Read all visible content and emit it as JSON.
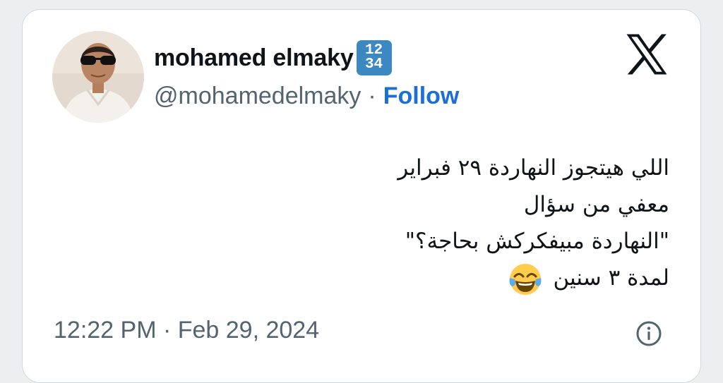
{
  "tweet": {
    "author": {
      "display_name": "mohamed elmaky",
      "name_emoji": "12\n34",
      "handle": "@mohamedelmaky",
      "separator": "·",
      "follow_label": "Follow",
      "avatar_icon": "profile-photo"
    },
    "text_lines": [
      "اللي هيتجوز النهاردة ٢٩ فبراير",
      "معفي من سؤال",
      "\"النهاردة مبيفكركش بحاجة؟\"",
      "لمدة ٣ سنين"
    ],
    "text_emoji": "face-with-tears-of-joy",
    "timestamp": "12:22 PM · Feb 29, 2024",
    "platform_icon": "x-logo",
    "info_icon": "info-icon"
  },
  "colors": {
    "background": "#eceef0",
    "card": "#ffffff",
    "card_border": "#cfd9de",
    "text_primary": "#0f1419",
    "text_secondary": "#536471",
    "follow": "#1d6fd6",
    "emoji_badge": "#3b88c3"
  }
}
